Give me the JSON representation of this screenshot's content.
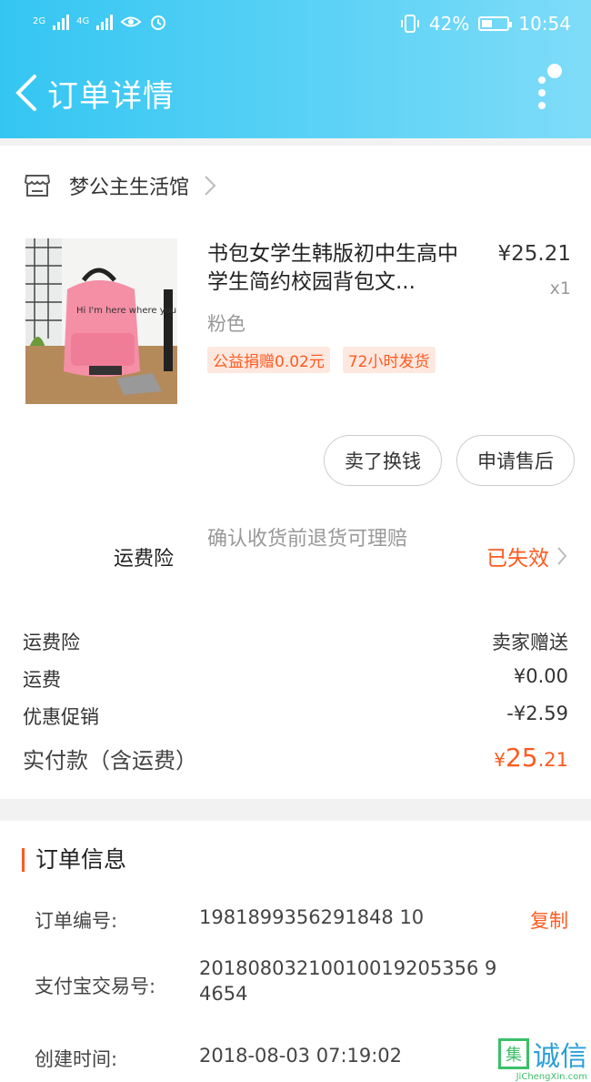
{
  "status_bar": {
    "net1": "2G",
    "net2": "4G",
    "battery": "42%",
    "time": "10:54"
  },
  "nav": {
    "title": "订单详情"
  },
  "shop": {
    "name": "梦公主生活馆"
  },
  "product": {
    "name": "书包女学生韩版初中生高中学生简约校园背包文...",
    "image_text": "Hi I'm here where you",
    "price": "¥25.21",
    "quantity": "x1",
    "variant": "粉色",
    "tags": [
      "公益捐赠0.02元",
      "72小时发货"
    ]
  },
  "actions": {
    "sell": "卖了换钱",
    "after_sale": "申请售后"
  },
  "insurance": {
    "label": "运费险",
    "desc": "确认收货前退货可理赔",
    "status": "已失效"
  },
  "summary": [
    {
      "label": "运费险",
      "value": "卖家赠送"
    },
    {
      "label": "运费",
      "value": "¥0.00"
    },
    {
      "label": "优惠促销",
      "value": "-¥2.59"
    }
  ],
  "total": {
    "label": "实付款（含运费）",
    "currency": "¥",
    "integer": "25",
    "decimal": ".21"
  },
  "order_info": {
    "title": "订单信息",
    "order_no_label": "订单编号:",
    "order_no": "1981899356291848 10",
    "copy": "复制",
    "alipay_label": "支付宝交易号:",
    "alipay_no": "20180803210010019205356 94654",
    "created_label": "创建时间:",
    "created": "2018-08-03 07:19:02"
  },
  "watermark": {
    "logo_char": "集",
    "text": "诚信",
    "url": "JiChengXin.com"
  },
  "colors": {
    "header": "#4ccdf4",
    "accent": "#ff5a1f",
    "tag_bg": "#fde8e0"
  }
}
